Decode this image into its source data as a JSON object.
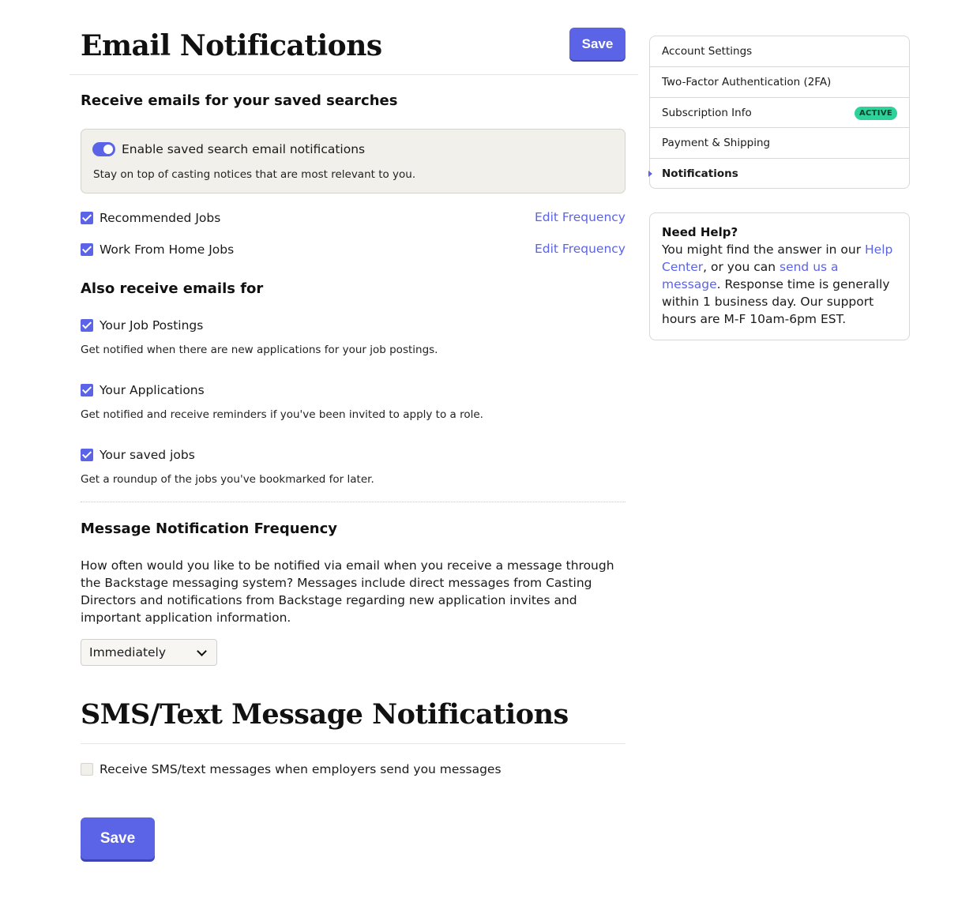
{
  "header": {
    "title": "Email Notifications",
    "save_label": "Save"
  },
  "saved_searches": {
    "heading": "Receive emails for your saved searches",
    "toggle_label": "Enable saved search email notifications",
    "toggle_desc": "Stay on top of casting notices that are most relevant to you.",
    "items": [
      {
        "label": "Recommended Jobs",
        "link": "Edit Frequency"
      },
      {
        "label": "Work From Home Jobs",
        "link": "Edit Frequency"
      }
    ]
  },
  "also": {
    "heading": "Also receive emails for",
    "items": [
      {
        "label": "Your Job Postings",
        "desc": "Get notified when there are new applications for your job postings."
      },
      {
        "label": "Your Applications",
        "desc": "Get notified and receive reminders if you've been invited to apply to a role."
      },
      {
        "label": "Your saved jobs",
        "desc": "Get a roundup of the jobs you've bookmarked for later."
      }
    ]
  },
  "frequency": {
    "heading": "Message Notification Frequency",
    "text": "How often would you like to be notified via email when you receive a message through the Backstage messaging system? Messages include direct messages from Casting Directors and notifications from Backstage regarding new application invites and important application information.",
    "selected": "Immediately"
  },
  "sms": {
    "title": "SMS/Text Message Notifications",
    "checkbox_label": "Receive SMS/text messages when employers send you messages",
    "save_label": "Save"
  },
  "sidebar": {
    "items": [
      {
        "label": "Account Settings"
      },
      {
        "label": "Two-Factor Authentication (2FA)"
      },
      {
        "label": "Subscription Info",
        "badge": "ACTIVE"
      },
      {
        "label": "Payment & Shipping"
      },
      {
        "label": "Notifications"
      }
    ]
  },
  "help": {
    "title": "Need Help?",
    "text_1": "You might find the answer in our ",
    "link_1": "Help Center",
    "text_2": ", or you can ",
    "link_2": "send us a message",
    "text_3": ". Response time is generally within 1 business day. Our support hours are M-F 10am-6pm EST."
  },
  "colors": {
    "accent": "#5b63e6",
    "badge": "#2ed199",
    "panel_bg": "#f2f0eb"
  }
}
